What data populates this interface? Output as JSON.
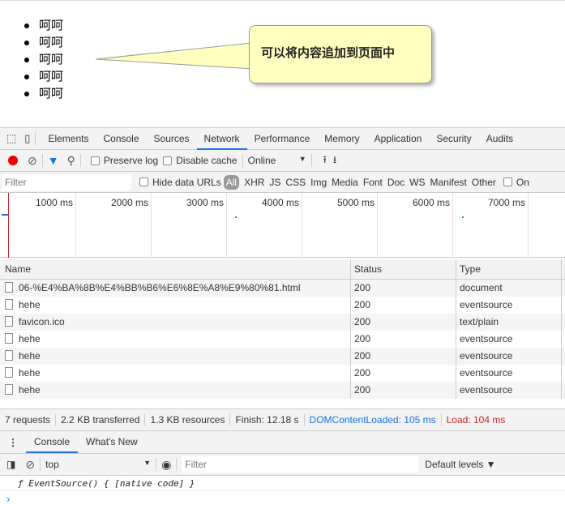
{
  "page": {
    "list_items": [
      "呵呵",
      "呵呵",
      "呵呵",
      "呵呵",
      "呵呵"
    ],
    "callout": "可以将内容追加到页面中"
  },
  "devtools": {
    "tabs": [
      "Elements",
      "Console",
      "Sources",
      "Network",
      "Performance",
      "Memory",
      "Application",
      "Security",
      "Audits"
    ],
    "active_tab": "Network",
    "toolbar": {
      "preserve_log": "Preserve log",
      "disable_cache": "Disable cache",
      "throttle": "Online"
    },
    "filter": {
      "placeholder": "Filter",
      "hide_data_urls": "Hide data URLs",
      "types": [
        "All",
        "XHR",
        "JS",
        "CSS",
        "Img",
        "Media",
        "Font",
        "Doc",
        "WS",
        "Manifest",
        "Other"
      ],
      "only": "On"
    },
    "timeline": {
      "ticks": [
        "1000 ms",
        "2000 ms",
        "3000 ms",
        "4000 ms",
        "5000 ms",
        "6000 ms",
        "7000 ms"
      ]
    },
    "table": {
      "headers": [
        "Name",
        "Status",
        "Type"
      ],
      "rows": [
        [
          "06-%E4%BA%8B%E4%BB%B6%E6%8E%A8%E9%80%81.html",
          "200",
          "document"
        ],
        [
          "hehe",
          "200",
          "eventsource"
        ],
        [
          "favicon.ico",
          "200",
          "text/plain"
        ],
        [
          "hehe",
          "200",
          "eventsource"
        ],
        [
          "hehe",
          "200",
          "eventsource"
        ],
        [
          "hehe",
          "200",
          "eventsource"
        ],
        [
          "hehe",
          "200",
          "eventsource"
        ]
      ]
    },
    "summary": {
      "requests": "7 requests",
      "transferred": "2.2 KB transferred",
      "resources": "1.3 KB resources",
      "finish": "Finish: 12.18 s",
      "dcl": "DOMContentLoaded: 105 ms",
      "load": "Load: 104 ms"
    },
    "drawer": {
      "tabs": [
        "Console",
        "What's New"
      ],
      "context": "top",
      "filter_placeholder": "Filter",
      "levels": "Default levels ▼",
      "output": "ƒ EventSource() { [native code] }",
      "prompt": "›"
    },
    "colors": {
      "accent": "#1a73e8",
      "record": "#e00",
      "dcl": "#1a73e8",
      "load": "#c62828"
    }
  }
}
